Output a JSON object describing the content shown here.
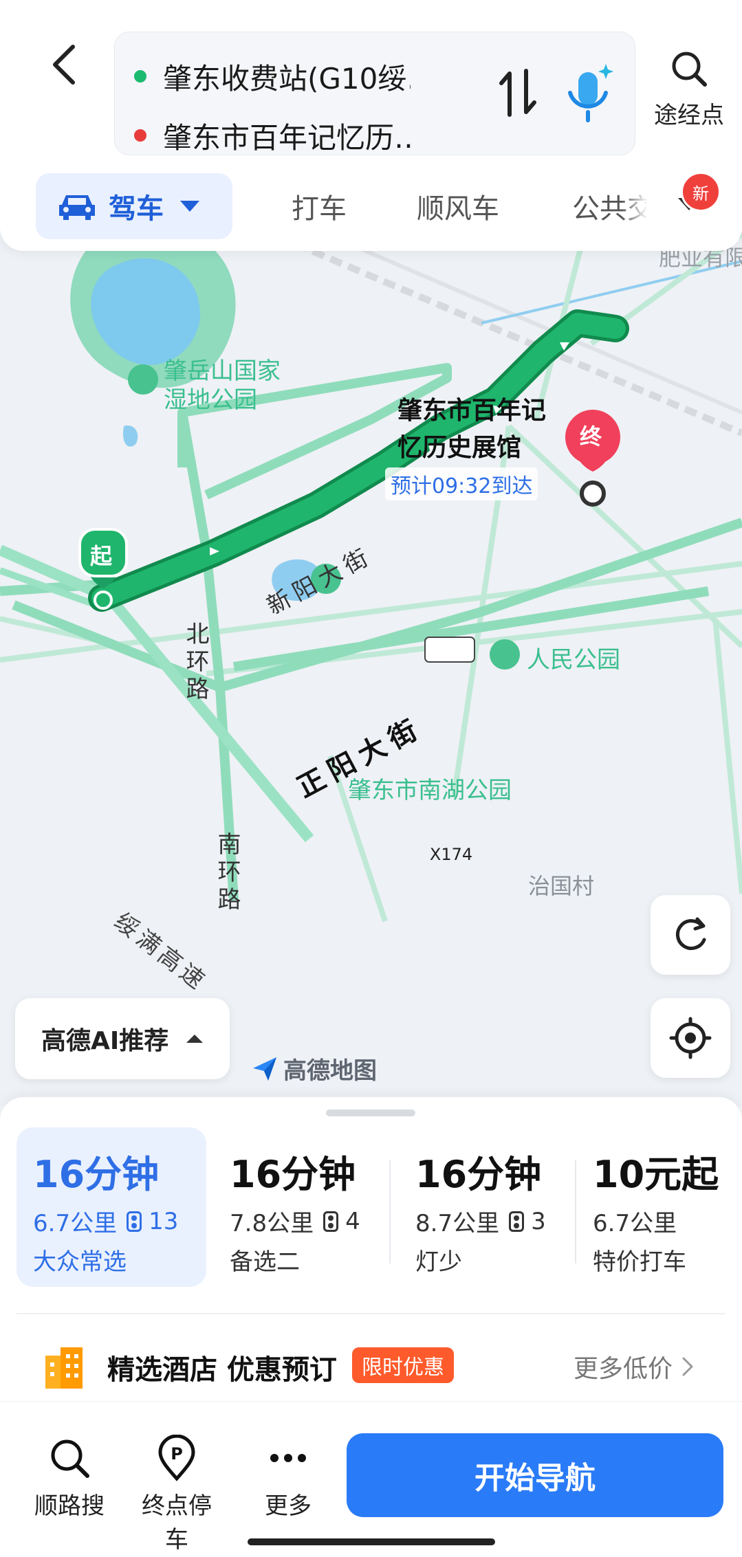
{
  "header": {
    "start_location": "肇东收费站(G10绥…",
    "end_location": "肇东市百年记忆历…",
    "waypoint_label": "途经点",
    "start_dot_color": "#1cba6f",
    "end_dot_color": "#e83c3c"
  },
  "tabs": {
    "drive": "驾车",
    "taxi": "打车",
    "carpool": "顺风车",
    "transit": "公共交",
    "new_badge": "新"
  },
  "map": {
    "poi_top_right": "肥业有限",
    "park_north_line1": "肇岳山国家",
    "park_north_line2": "湿地公园",
    "destination_line1": "肇东市百年记",
    "destination_line2": "忆历史展馆",
    "eta": "预计09:32到达",
    "end_marker": "终",
    "start_marker": "起",
    "road_xinyang": "新阳大街",
    "road_zhengyang": "正阳大街",
    "road_beihuan": "北环路",
    "road_nanhuan": "南环路",
    "road_suiman": "绥满高速",
    "park_renmin": "人民公园",
    "park_nanhu": "肇东市南湖公园",
    "road_x174": "X174",
    "village": "治国村",
    "ai_recommend": "高德AI推荐",
    "logo_text": "高德地图",
    "route_color": "#1fb56c"
  },
  "routes": [
    {
      "time": "16分钟",
      "distance": "6.7公里",
      "lights": "13",
      "tag": "大众常选",
      "selected": true
    },
    {
      "time": "16分钟",
      "distance": "7.8公里",
      "lights": "4",
      "tag": "备选二"
    },
    {
      "time": "16分钟",
      "distance": "8.7公里",
      "lights": "3",
      "tag": "灯少"
    },
    {
      "time": "10元起",
      "distance": "6.7公里",
      "tag": "特价打车"
    }
  ],
  "hotel": {
    "title": "精选酒店 优惠预订",
    "badge": "限时优惠",
    "more": "更多低价"
  },
  "bottom_bar": {
    "search_along": "顺路搜",
    "parking": "终点停车",
    "more": "更多",
    "start_nav": "开始导航"
  }
}
